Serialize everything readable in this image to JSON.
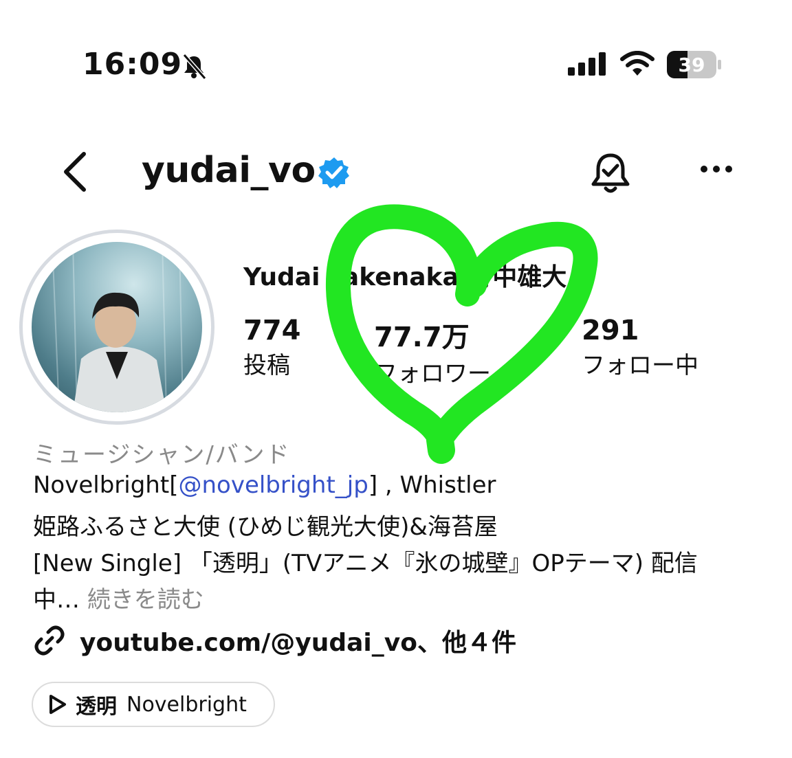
{
  "status_bar": {
    "time": "16:09",
    "battery": "39",
    "icons": [
      "bell-slash-icon",
      "cellular-signal-icon",
      "wifi-icon",
      "battery-icon"
    ]
  },
  "header": {
    "username": "yudai_vo",
    "icons": [
      "chevron-left-icon",
      "verified-badge-icon",
      "notification-bell-check-icon",
      "more-dots-icon"
    ]
  },
  "profile": {
    "display_name": "Yudai Takenaka 竹中雄大",
    "stats": [
      {
        "value": "774",
        "label": "投稿"
      },
      {
        "value": "77.7万",
        "label": "フォロワー"
      },
      {
        "value": "291",
        "label": "フォロー中"
      }
    ],
    "category": "ミュージシャン/バンド",
    "bio": {
      "line1_prefix": "Novelbright[",
      "line1_mention": "@novelbright_jp",
      "line1_suffix": "] , Whistler",
      "line2": "姫路ふるさと大使 (ひめじ観光大使)&海苔屋",
      "line3": "[New Single] 「透明」(TVアニメ『氷の城壁』OPテーマ) 配信",
      "line4_prefix": "中…",
      "more_label": "続きを読む"
    },
    "link": "youtube.com/@yudai_vo、他４件",
    "music": {
      "title": "透明",
      "artist": "Novelbright"
    }
  },
  "colors": {
    "accent_link": "#3551c8",
    "verified": "#1d9bf0",
    "overlay_heart": "#22e622"
  }
}
